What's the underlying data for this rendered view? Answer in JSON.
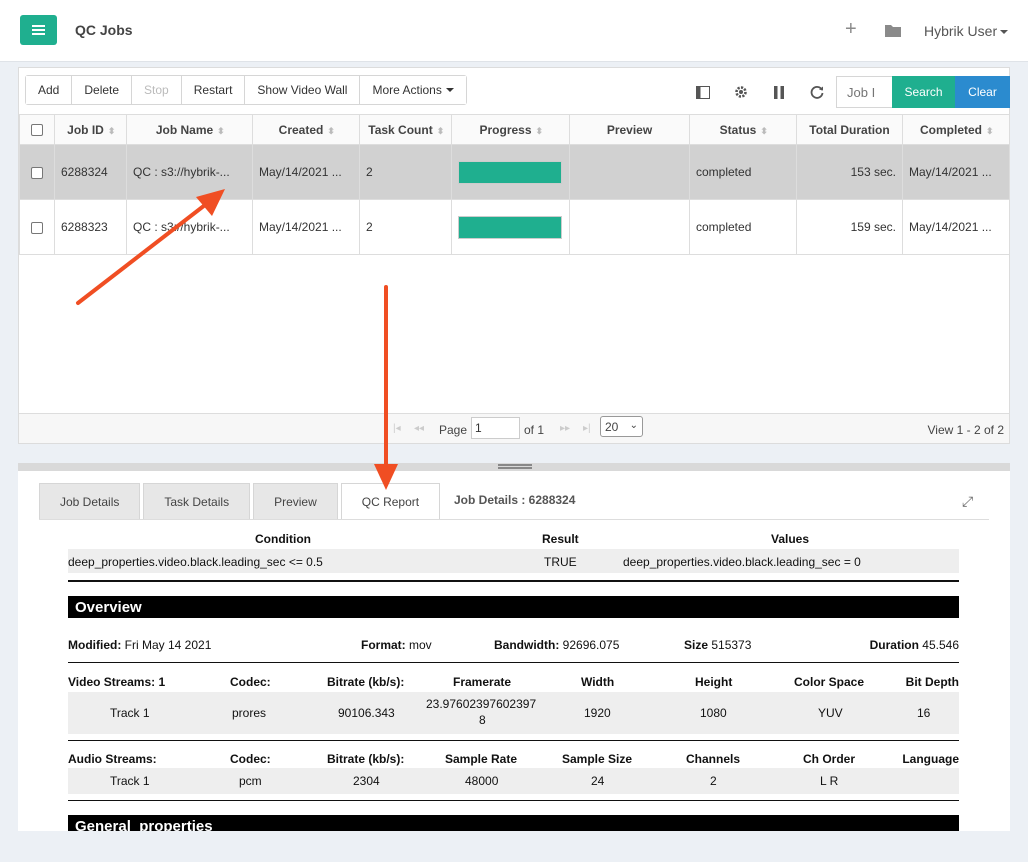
{
  "header": {
    "title": "QC Jobs",
    "user": "Hybrik User"
  },
  "toolbar": {
    "buttons": [
      "Add",
      "Delete",
      "Stop",
      "Restart",
      "Show Video Wall",
      "More Actions"
    ],
    "search_placeholder": "Job I",
    "search_label": "Search",
    "clear_label": "Clear"
  },
  "grid": {
    "columns": [
      "Job ID",
      "Job Name",
      "Created",
      "Task Count",
      "Progress",
      "Preview",
      "Status",
      "Total Duration",
      "Completed"
    ],
    "rows": [
      {
        "id": "6288324",
        "name": "QC  : s3://hybrik-...",
        "created": "May/14/2021 ...",
        "tasks": "2",
        "progress": 1.0,
        "preview": "",
        "status": "completed",
        "duration": "153 sec.",
        "completed": "May/14/2021 ...",
        "selected": true
      },
      {
        "id": "6288323",
        "name": "QC  : s3://hybrik-...",
        "created": "May/14/2021 ...",
        "tasks": "2",
        "progress": 1.0,
        "preview": "",
        "status": "completed",
        "duration": "159 sec.",
        "completed": "May/14/2021 ...",
        "selected": false
      }
    ]
  },
  "pager": {
    "page_label": "Page",
    "page_value": "1",
    "of_label": "of 1",
    "page_size": "20",
    "view_text": "View 1 - 2 of 2"
  },
  "detail": {
    "tabs": [
      "Job Details",
      "Task Details",
      "Preview",
      "QC Report"
    ],
    "active_tab": 3,
    "title": "Job Details : 6288324"
  },
  "report": {
    "condition_header": {
      "condition": "Condition",
      "result": "Result",
      "values": "Values"
    },
    "condition_row": {
      "condition": "deep_properties.video.black.leading_sec <= 0.5",
      "result": "TRUE",
      "values": "deep_properties.video.black.leading_sec = 0"
    },
    "overview_title": "Overview",
    "general_title": "General_properties",
    "summary": {
      "modified_label": "Modified:",
      "modified": "Fri May 14 2021",
      "format_label": "Format:",
      "format": "mov",
      "bandwidth_label": "Bandwidth:",
      "bandwidth": "92696.075",
      "size_label": "Size",
      "size": "515373",
      "duration_label": "Duration",
      "duration": "45.546"
    },
    "video": {
      "headers": [
        "Video Streams: 1",
        "Codec:",
        "Bitrate (kb/s):",
        "Framerate",
        "Width",
        "Height",
        "Color Space",
        "Bit Depth"
      ],
      "row": [
        "Track 1",
        "prores",
        "90106.343",
        "23.97602397602397",
        "1920",
        "1080",
        "YUV",
        "16"
      ],
      "framerate_wrap": "8"
    },
    "audio": {
      "headers": [
        "Audio Streams:",
        "Codec:",
        "Bitrate (kb/s):",
        "Sample Rate",
        "Sample Size",
        "Channels",
        "Ch Order",
        "Language"
      ],
      "row": [
        "Track 1",
        "pcm",
        "2304",
        "48000",
        "24",
        "2",
        "L R",
        ""
      ]
    }
  },
  "colors": {
    "accent_green": "#1faf8f",
    "accent_blue": "#2b8bcf",
    "annotation_arrow": "#f04e23"
  }
}
